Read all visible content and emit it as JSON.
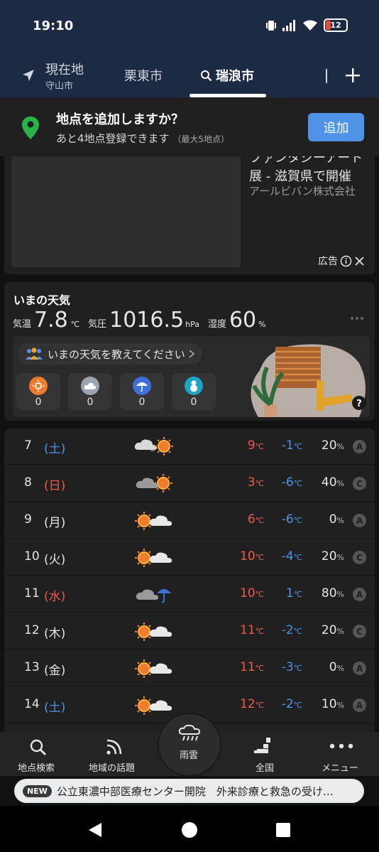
{
  "status": {
    "time": "19:10",
    "battery": "12"
  },
  "tabs": [
    {
      "label": "現在地",
      "sub": "守山市"
    },
    {
      "label": "栗東市"
    },
    {
      "label": "瑞浪市"
    }
  ],
  "add_location": {
    "title": "地点を追加しますか？",
    "subtitle": "あと4地点登録できます",
    "note": "（最大5地点）",
    "button": "追加"
  },
  "ad": {
    "headline_line1": "ファンタジーアート",
    "headline_line2": "展 - 滋賀県で開催",
    "advertiser": "アールビバン株式会社",
    "ad_label": "広告"
  },
  "now": {
    "title": "いまの天気",
    "temp_label": "気温",
    "temp": "7.8",
    "temp_unit": "℃",
    "pressure_label": "気圧",
    "pressure": "1016.5",
    "pressure_unit": "hPa",
    "humidity_label": "湿度",
    "humidity": "60",
    "humidity_unit": "%",
    "prompt": "いまの天気を教えてください",
    "votes": [
      {
        "icon": "sun-icon",
        "count": "0"
      },
      {
        "icon": "cloud-icon",
        "count": "0"
      },
      {
        "icon": "umbrella-icon",
        "count": "0"
      },
      {
        "icon": "snowman-icon",
        "count": "0"
      }
    ],
    "help": "?"
  },
  "forecast": [
    {
      "day": "7",
      "dow": "(土)",
      "dow_color": "#4f93e6",
      "icon": "cloudy-then-sunny",
      "hi": "9",
      "lo": "-1",
      "pop": "20",
      "rank": "A"
    },
    {
      "day": "8",
      "dow": "(日)",
      "dow_color": "#f05a4d",
      "icon": "cloudy-sunny",
      "hi": "3",
      "lo": "-6",
      "pop": "40",
      "rank": "C"
    },
    {
      "day": "9",
      "dow": "(月)",
      "dow_color": "#e6e6e6",
      "icon": "sunny-cloudy",
      "hi": "6",
      "lo": "-6",
      "pop": "0",
      "rank": "A"
    },
    {
      "day": "10",
      "dow": "(火)",
      "dow_color": "#e6e6e6",
      "icon": "sunny-cloudy",
      "hi": "10",
      "lo": "-4",
      "pop": "20",
      "rank": "C"
    },
    {
      "day": "11",
      "dow": "(水)",
      "dow_color": "#f05a4d",
      "icon": "cloudy-rain",
      "hi": "10",
      "lo": "1",
      "pop": "80",
      "rank": "A"
    },
    {
      "day": "12",
      "dow": "(木)",
      "dow_color": "#e6e6e6",
      "icon": "sunny-cloudy",
      "hi": "11",
      "lo": "-2",
      "pop": "20",
      "rank": "C"
    },
    {
      "day": "13",
      "dow": "(金)",
      "dow_color": "#e6e6e6",
      "icon": "sunny-cloudy",
      "hi": "11",
      "lo": "-3",
      "pop": "0",
      "rank": "A"
    },
    {
      "day": "14",
      "dow": "(土)",
      "dow_color": "#4f93e6",
      "icon": "sunny-cloudy",
      "hi": "12",
      "lo": "-2",
      "pop": "10",
      "rank": "A"
    }
  ],
  "units": {
    "temp": "℃",
    "pop": "%"
  },
  "nav": [
    {
      "label": "地点検索"
    },
    {
      "label": "地域の話題"
    },
    {
      "label": "雨雲"
    },
    {
      "label": "全国"
    },
    {
      "label": "メニュー"
    }
  ],
  "ticker": {
    "badge": "NEW",
    "text": "公立東濃中部医療センター開院　外来診療と救急の受け…"
  }
}
